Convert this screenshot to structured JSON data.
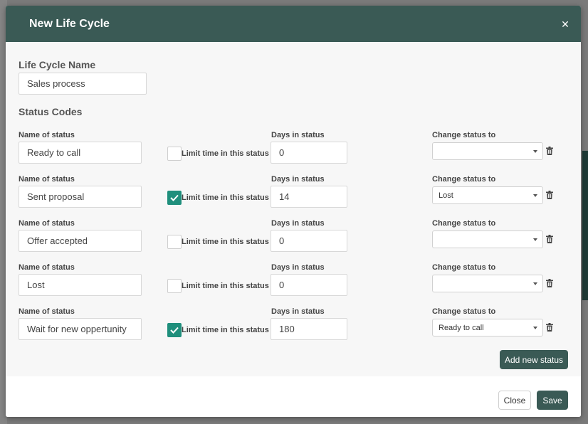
{
  "modal": {
    "title": "New Life Cycle",
    "close_icon": "close-icon"
  },
  "form": {
    "name_label": "Life Cycle Name",
    "name_value": "Sales process",
    "status_codes_label": "Status Codes",
    "field_labels": {
      "name_of_status": "Name of status",
      "limit_time": "Limit time in this status",
      "days_in_status": "Days in status",
      "change_status_to": "Change status to"
    },
    "statuses": [
      {
        "name": "Ready to call",
        "limit": false,
        "days": "0",
        "change_to": ""
      },
      {
        "name": "Sent proposal",
        "limit": true,
        "days": "14",
        "change_to": "Lost"
      },
      {
        "name": "Offer accepted",
        "limit": false,
        "days": "0",
        "change_to": ""
      },
      {
        "name": "Lost",
        "limit": false,
        "days": "0",
        "change_to": ""
      },
      {
        "name": "Wait for new oppertunity",
        "limit": true,
        "days": "180",
        "change_to": "Ready to call"
      }
    ],
    "add_status_label": "Add new status"
  },
  "footer": {
    "close_label": "Close",
    "save_label": "Save"
  },
  "colors": {
    "header": "#3a5a55",
    "checkbox_checked": "#1f8f7c",
    "body_bg": "#f7f7f7"
  },
  "icons": {
    "checkbox_check": "check-icon",
    "dropdown": "chevron-down-icon",
    "delete": "trash-icon"
  }
}
